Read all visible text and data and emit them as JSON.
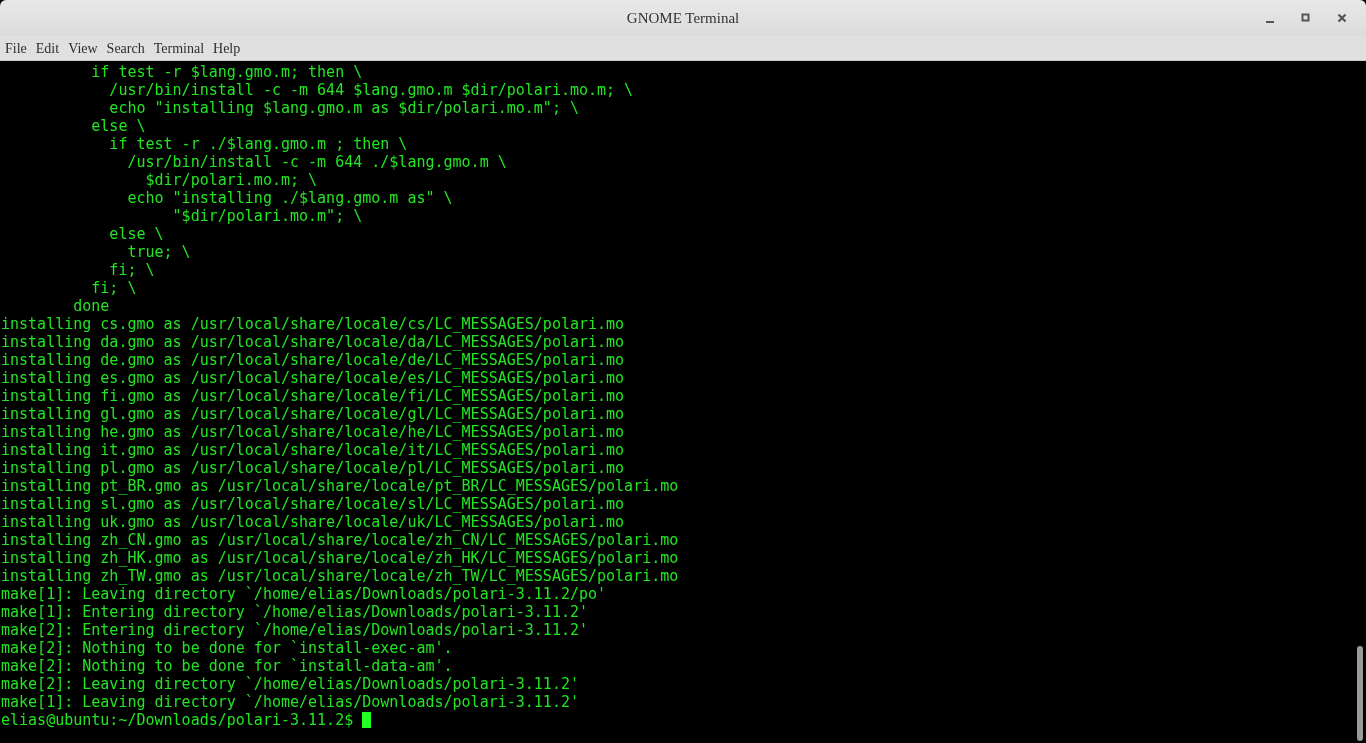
{
  "window": {
    "title": "GNOME Terminal"
  },
  "menu": [
    "File",
    "Edit",
    "View",
    "Search",
    "Terminal",
    "Help"
  ],
  "terminal": {
    "lines": [
      "          if test -r $lang.gmo.m; then \\",
      "            /usr/bin/install -c -m 644 $lang.gmo.m $dir/polari.mo.m; \\",
      "            echo \"installing $lang.gmo.m as $dir/polari.mo.m\"; \\",
      "          else \\",
      "            if test -r ./$lang.gmo.m ; then \\",
      "              /usr/bin/install -c -m 644 ./$lang.gmo.m \\",
      "                $dir/polari.mo.m; \\",
      "              echo \"installing ./$lang.gmo.m as\" \\",
      "                   \"$dir/polari.mo.m\"; \\",
      "            else \\",
      "              true; \\",
      "            fi; \\",
      "          fi; \\",
      "        done",
      "installing cs.gmo as /usr/local/share/locale/cs/LC_MESSAGES/polari.mo",
      "installing da.gmo as /usr/local/share/locale/da/LC_MESSAGES/polari.mo",
      "installing de.gmo as /usr/local/share/locale/de/LC_MESSAGES/polari.mo",
      "installing es.gmo as /usr/local/share/locale/es/LC_MESSAGES/polari.mo",
      "installing fi.gmo as /usr/local/share/locale/fi/LC_MESSAGES/polari.mo",
      "installing gl.gmo as /usr/local/share/locale/gl/LC_MESSAGES/polari.mo",
      "installing he.gmo as /usr/local/share/locale/he/LC_MESSAGES/polari.mo",
      "installing it.gmo as /usr/local/share/locale/it/LC_MESSAGES/polari.mo",
      "installing pl.gmo as /usr/local/share/locale/pl/LC_MESSAGES/polari.mo",
      "installing pt_BR.gmo as /usr/local/share/locale/pt_BR/LC_MESSAGES/polari.mo",
      "installing sl.gmo as /usr/local/share/locale/sl/LC_MESSAGES/polari.mo",
      "installing uk.gmo as /usr/local/share/locale/uk/LC_MESSAGES/polari.mo",
      "installing zh_CN.gmo as /usr/local/share/locale/zh_CN/LC_MESSAGES/polari.mo",
      "installing zh_HK.gmo as /usr/local/share/locale/zh_HK/LC_MESSAGES/polari.mo",
      "installing zh_TW.gmo as /usr/local/share/locale/zh_TW/LC_MESSAGES/polari.mo",
      "make[1]: Leaving directory `/home/elias/Downloads/polari-3.11.2/po'",
      "make[1]: Entering directory `/home/elias/Downloads/polari-3.11.2'",
      "make[2]: Entering directory `/home/elias/Downloads/polari-3.11.2'",
      "make[2]: Nothing to be done for `install-exec-am'.",
      "make[2]: Nothing to be done for `install-data-am'.",
      "make[2]: Leaving directory `/home/elias/Downloads/polari-3.11.2'",
      "make[1]: Leaving directory `/home/elias/Downloads/polari-3.11.2'"
    ],
    "prompt": "elias@ubuntu:~/Downloads/polari-3.11.2$"
  }
}
